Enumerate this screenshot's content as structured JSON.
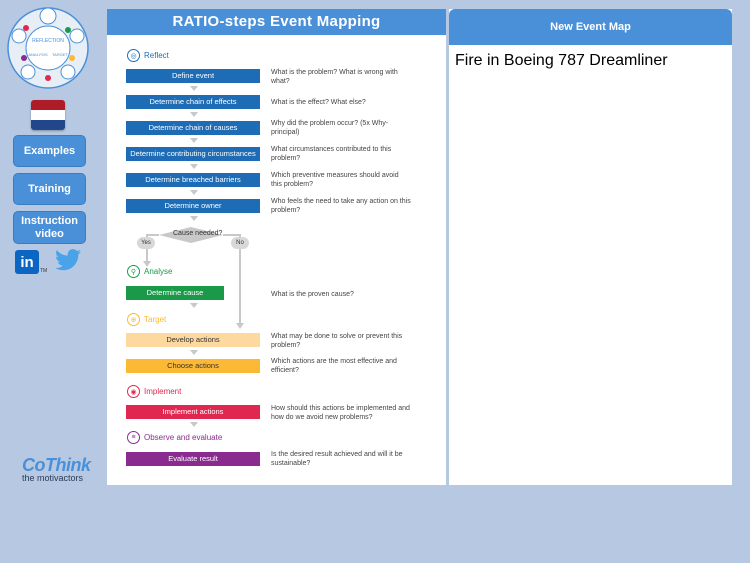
{
  "sidebar": {
    "logo_texts": [
      "REFLECTION",
      "ANALYSIS",
      "TARGET"
    ],
    "flag": "netherlands-flag",
    "buttons": [
      "Examples",
      "Training",
      "Instruction video"
    ],
    "linkedin_text": "in",
    "linkedin_tm": "TM",
    "brand_name": "CoThink",
    "brand_tagline": "the motivactors"
  },
  "main": {
    "title": "RATIO-steps Event Mapping",
    "sections": {
      "reflect": "Reflect",
      "analyse": "Analyse",
      "target": "Target",
      "implement": "Implement",
      "observe": "Observe and evaluate"
    },
    "steps": [
      {
        "label": "Define event",
        "question": "What is the problem? What is wrong with what?"
      },
      {
        "label": "Determine chain of effects",
        "question": "What is the effect? What else?"
      },
      {
        "label": "Determine chain of causes",
        "question": "Why did the problem occur? (5x Why-principal)"
      },
      {
        "label": "Determine contributing circumstances",
        "question": "What circumstances contributed to this problem?"
      },
      {
        "label": "Determine breached barriers",
        "question": "Which preventive measures should avoid this problem?"
      },
      {
        "label": "Determine owner",
        "question": "Who feels the need to take any action on this problem?"
      },
      {
        "label": "Determine cause",
        "question": "What is the proven cause?"
      },
      {
        "label": "Develop actions",
        "question": "What may be done to solve or prevent this problem?"
      },
      {
        "label": "Choose actions",
        "question": "Which actions are the most effective and efficient?"
      },
      {
        "label": "Implement actions",
        "question": "How should this actions be implemented and how do we avoid new problems?"
      },
      {
        "label": "Evaluate result",
        "question": "Is the desired result achieved and will it be sustainable?"
      }
    ],
    "decision": {
      "label": "Cause needed?",
      "yes": "Yes",
      "no": "No"
    }
  },
  "right": {
    "header": "New Event Map",
    "map_title": "Fire in Boeing 787 Dreamliner"
  },
  "colors": {
    "blue": "#1e6cb5",
    "green": "#1a9a49",
    "orange_light": "#fdd9a0",
    "orange": "#fbb935",
    "red": "#e0274f",
    "purple": "#8a2c8f",
    "header_blue": "#4a90d9"
  }
}
